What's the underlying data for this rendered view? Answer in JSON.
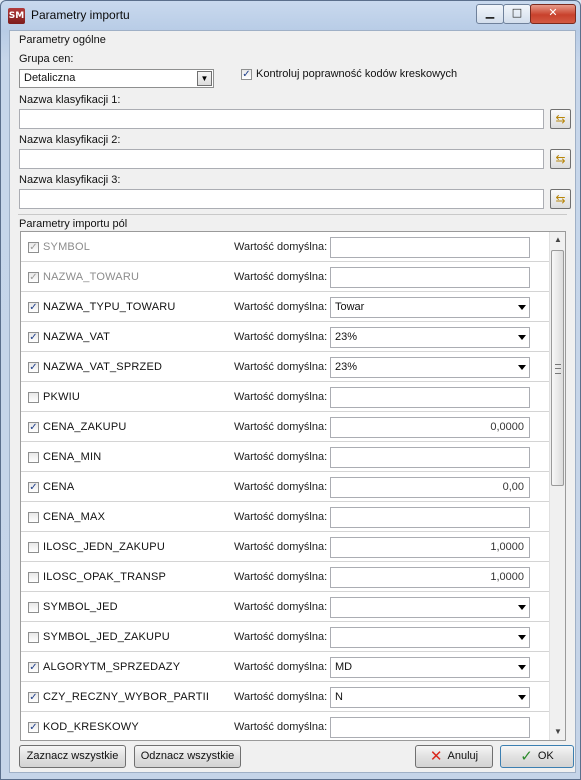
{
  "window": {
    "title": "Parametry importu",
    "app_icon_text": "SM"
  },
  "general": {
    "section_title": "Parametry ogólne",
    "price_group_label": "Grupa cen:",
    "price_group_value": "Detaliczna",
    "barcode_check_label": "Kontroluj poprawność kodów kreskowych",
    "barcode_check_checked": true,
    "class1_label": "Nazwa klasyfikacji 1:",
    "class1_value": "",
    "class2_label": "Nazwa klasyfikacji 2:",
    "class2_value": "",
    "class3_label": "Nazwa klasyfikacji 3:",
    "class3_value": ""
  },
  "fields": {
    "section_title": "Parametry importu pól",
    "default_label": "Wartość domyślna:",
    "rows": [
      {
        "name": "SYMBOL",
        "checked": true,
        "disabled": true,
        "kind": "text",
        "value": ""
      },
      {
        "name": "NAZWA_TOWARU",
        "checked": true,
        "disabled": true,
        "kind": "text",
        "value": ""
      },
      {
        "name": "NAZWA_TYPU_TOWARU",
        "checked": true,
        "disabled": false,
        "kind": "select",
        "value": "Towar"
      },
      {
        "name": "NAZWA_VAT",
        "checked": true,
        "disabled": false,
        "kind": "select",
        "value": "23%"
      },
      {
        "name": "NAZWA_VAT_SPRZED",
        "checked": true,
        "disabled": false,
        "kind": "select",
        "value": "23%"
      },
      {
        "name": "PKWIU",
        "checked": false,
        "disabled": false,
        "kind": "text",
        "value": ""
      },
      {
        "name": "CENA_ZAKUPU",
        "checked": true,
        "disabled": false,
        "kind": "number",
        "value": "0,0000"
      },
      {
        "name": "CENA_MIN",
        "checked": false,
        "disabled": false,
        "kind": "text",
        "value": ""
      },
      {
        "name": "CENA",
        "checked": true,
        "disabled": false,
        "kind": "number",
        "value": "0,00"
      },
      {
        "name": "CENA_MAX",
        "checked": false,
        "disabled": false,
        "kind": "text",
        "value": ""
      },
      {
        "name": "ILOSC_JEDN_ZAKUPU",
        "checked": false,
        "disabled": false,
        "kind": "number",
        "value": "1,0000"
      },
      {
        "name": "ILOSC_OPAK_TRANSP",
        "checked": false,
        "disabled": false,
        "kind": "number",
        "value": "1,0000"
      },
      {
        "name": "SYMBOL_JED",
        "checked": false,
        "disabled": false,
        "kind": "select",
        "value": ""
      },
      {
        "name": "SYMBOL_JED_ZAKUPU",
        "checked": false,
        "disabled": false,
        "kind": "select",
        "value": ""
      },
      {
        "name": "ALGORYTM_SPRZEDAZY",
        "checked": true,
        "disabled": false,
        "kind": "select",
        "value": "MD"
      },
      {
        "name": "CZY_RECZNY_WYBOR_PARTII",
        "checked": true,
        "disabled": false,
        "kind": "select",
        "value": "N"
      },
      {
        "name": "KOD_KRESKOWY",
        "checked": true,
        "disabled": false,
        "kind": "text",
        "value": ""
      }
    ]
  },
  "footer": {
    "select_all": "Zaznacz wszystkie",
    "deselect_all": "Odznacz wszystkie",
    "cancel": "Anuluj",
    "ok": "OK"
  },
  "icons": {
    "checkmark": "✓",
    "dropdown": "▼",
    "cancel": "✕",
    "ok": "✓",
    "picker": "⇆"
  }
}
